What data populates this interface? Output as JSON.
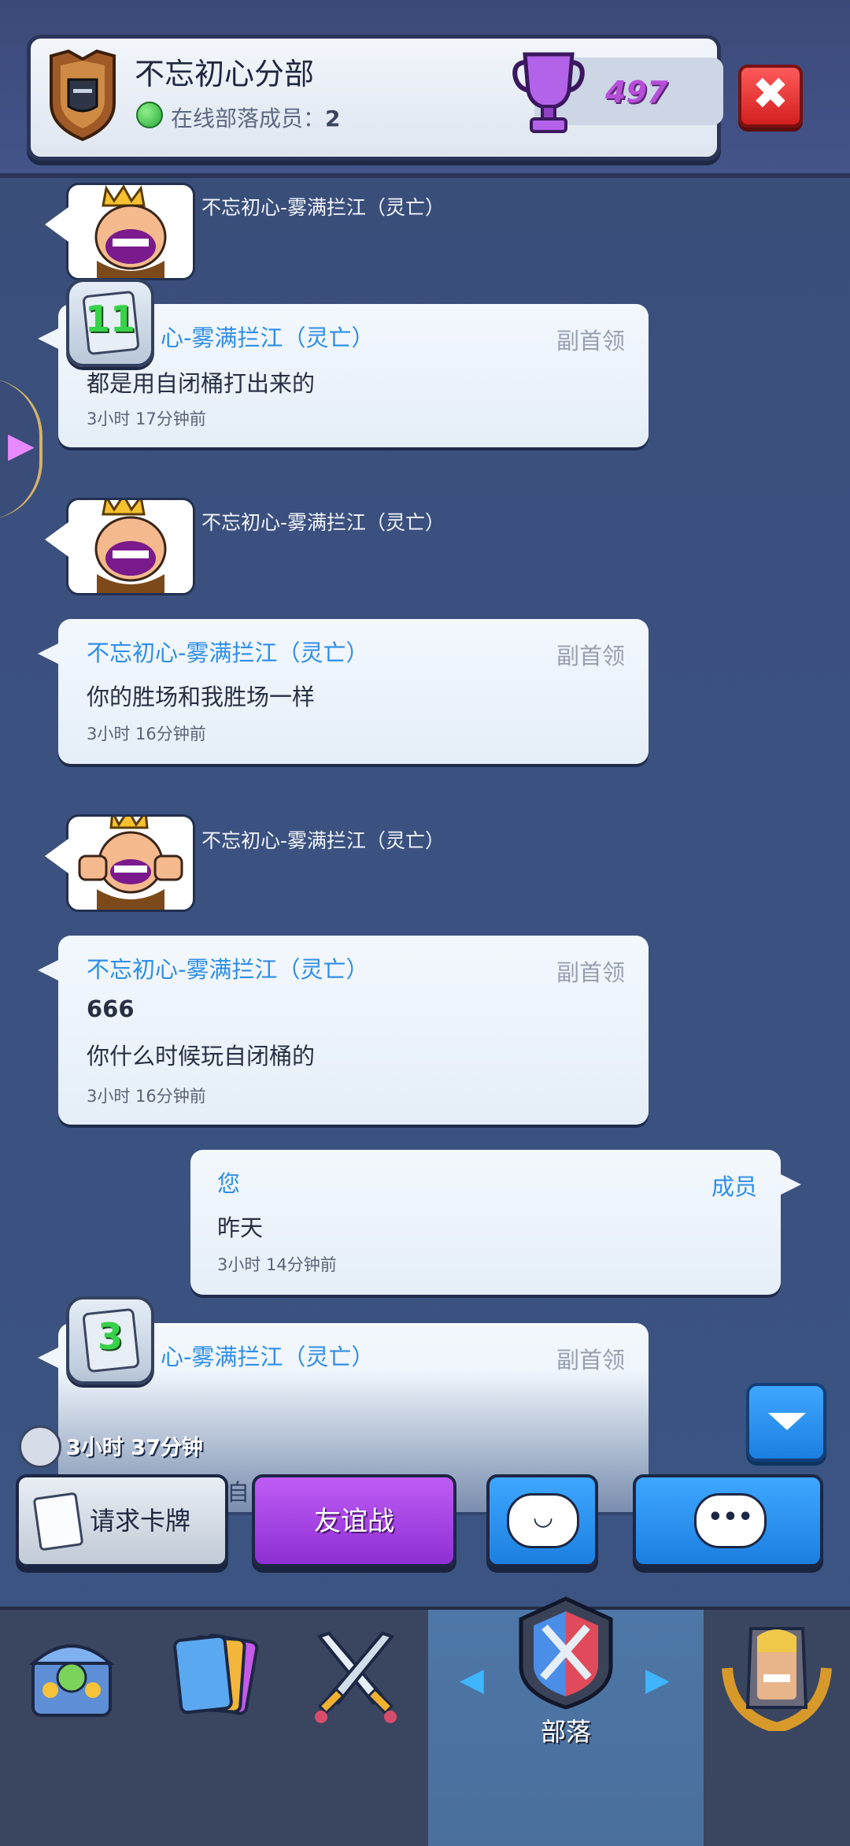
{
  "header": {
    "clan_name": "不忘初心分部",
    "online_label": "在线部落成员：",
    "online_count": "2",
    "trophies": "497",
    "close_label": "✖"
  },
  "messages": [
    {
      "avatar_name": "不忘初心-雾满拦江（灵亡）",
      "sender": "不忘初心-雾满拦江（灵亡）",
      "role": "副首领",
      "lines": [
        "都是用自闭桶打出来的"
      ],
      "time": "3小时 17分钟前",
      "level": "11"
    },
    {
      "avatar_name": "不忘初心-雾满拦江（灵亡）",
      "sender": "不忘初心-雾满拦江（灵亡）",
      "role": "副首领",
      "lines": [
        "你的胜场和我胜场一样"
      ],
      "time": "3小时 16分钟前"
    },
    {
      "avatar_name": "不忘初心-雾满拦江（灵亡）",
      "sender": "不忘初心-雾满拦江（灵亡）",
      "role": "副首领",
      "lines": [
        "666",
        "你什么时候玩自闭桶的"
      ],
      "time": "3小时 16分钟前"
    },
    {
      "sender": "您",
      "role": "成员",
      "lines": [
        "昨天"
      ],
      "time": "3小时 14分钟前"
    },
    {
      "sender": "不忘初心-雾满拦江（灵亡）",
      "role": "副首领",
      "lines": [
        "自"
      ],
      "level": "3"
    }
  ],
  "timer": "3小时 37分钟",
  "actions": {
    "request": "请求卡牌",
    "friendly": "友谊战",
    "emote_glyph": "◡",
    "chat_glyph": "•••"
  },
  "nav": {
    "clan_label": "部落",
    "left_arrow": "◀",
    "right_arrow": "▶"
  },
  "icons": [
    "shield-icon",
    "trophy-icon",
    "close-icon",
    "chest-shop-icon",
    "cards-icon",
    "battle-swords-icon",
    "clan-icon",
    "profile-icon",
    "timer-icon",
    "chevron-down-icon"
  ]
}
